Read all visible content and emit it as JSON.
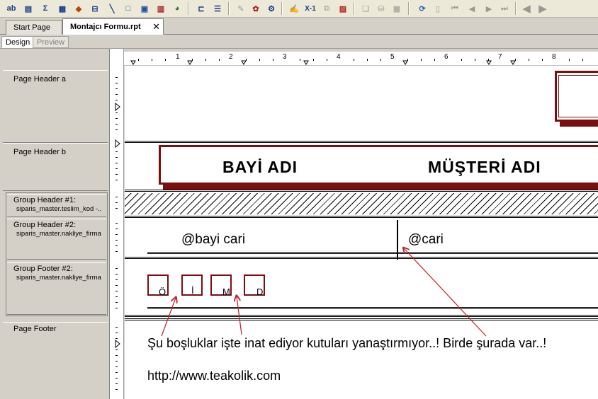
{
  "toolbar": {
    "icons": [
      "text-object-icon",
      "field-object-icon",
      "summary-icon",
      "cross-tab-icon",
      "ole-icon",
      "subreport-icon",
      "line-icon",
      "box-icon",
      "picture-icon",
      "chart-icon",
      "map-icon",
      "group-icon",
      "expert-icon",
      "format-icon",
      "select-expert-icon",
      "record-sort-icon",
      "formula-icon",
      "hide-icon",
      "report-icon",
      "sql-icon",
      "database-icon",
      "print-icon",
      "refresh-icon",
      "export-icon",
      "first-page-icon",
      "prev-page-icon",
      "next-page-icon",
      "last-page-icon",
      "back-icon",
      "forward-icon"
    ],
    "text_button_label": "ab",
    "sum_button_label": "Σ",
    "x1_button_label": "X-1"
  },
  "tabs": [
    {
      "label": "Start Page",
      "active": false
    },
    {
      "label": "Montajcı Formu.rpt",
      "active": true
    }
  ],
  "tab_close_label": "✕",
  "modes": [
    {
      "label": "Design",
      "active": true
    },
    {
      "label": "Preview",
      "active": false
    }
  ],
  "ruler": {
    "numbers": [
      "1",
      "2",
      "3",
      "4",
      "5",
      "6",
      "7",
      "8"
    ]
  },
  "sections": {
    "page_header_a": "Page Header a",
    "page_header_b": "Page Header b",
    "group_header_1": "Group Header #1:",
    "group_header_1_field": "siparis_master.teslim_kod -..",
    "group_header_2": "Group Header #2:",
    "group_header_2_field": "siparis_master.nakliye_firma",
    "group_footer_2": "Group Footer #2:",
    "group_footer_2_field": "siparis_master.nakliye_firma",
    "page_footer": "Page Footer"
  },
  "report": {
    "header_bayi": "BAYİ ADI",
    "header_musteri": "MÜŞTERİ ADI",
    "field_bayi_cari": "@bayi cari",
    "field_cari": "@cari",
    "letters": [
      "Ö",
      "İ",
      "M",
      "D"
    ],
    "note": "Şu boşluklar işte inat ediyor kutuları yanaştırmıyor..!  Birde şurada var..!",
    "url": "http://www.teakolik.com"
  },
  "colors": {
    "accent": "#7b0e0e",
    "arrow": "#c0202a"
  }
}
